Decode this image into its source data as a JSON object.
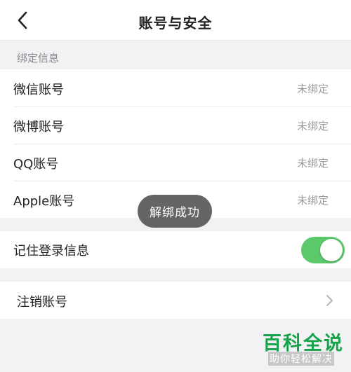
{
  "header": {
    "title": "账号与安全",
    "back_icon": "chevron-left-icon"
  },
  "binding": {
    "section_label": "绑定信息",
    "items": [
      {
        "label": "微信账号",
        "status": "未绑定"
      },
      {
        "label": "微博账号",
        "status": "未绑定"
      },
      {
        "label": "QQ账号",
        "status": "未绑定"
      },
      {
        "label": "Apple账号",
        "status": "未绑定"
      }
    ]
  },
  "remember": {
    "label": "记住登录信息",
    "toggle_on": true,
    "toggle_color": "#5bc96a"
  },
  "deactivate": {
    "label": "注销账号",
    "chevron_icon": "chevron-right-icon"
  },
  "toast": {
    "text": "解绑成功"
  },
  "watermark": {
    "main": "百科全说",
    "sub": "助你轻松解决"
  }
}
